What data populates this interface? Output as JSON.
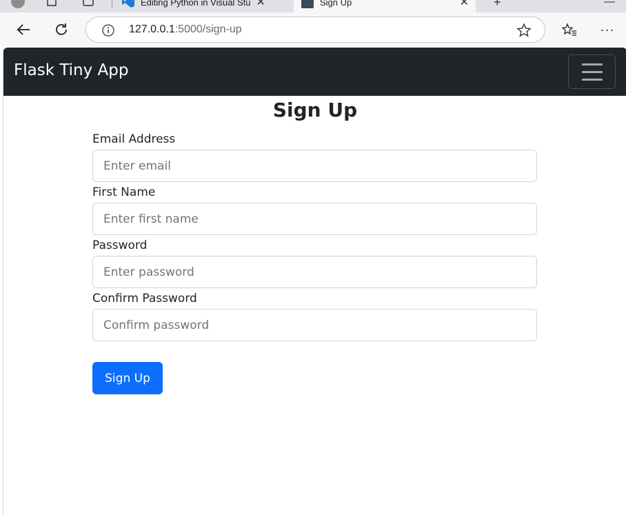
{
  "browser": {
    "tabs": [
      {
        "label": "Editing Python in Visual Stu"
      },
      {
        "label": "Sign Up"
      }
    ],
    "address": {
      "host": "127.0.0.1",
      "path": ":5000/sign-up"
    }
  },
  "navbar": {
    "brand": "Flask Tiny App"
  },
  "form": {
    "title": "Sign Up",
    "fields": [
      {
        "label": "Email Address",
        "placeholder": "Enter email"
      },
      {
        "label": "First Name",
        "placeholder": "Enter first name"
      },
      {
        "label": "Password",
        "placeholder": "Enter password"
      },
      {
        "label": "Confirm Password",
        "placeholder": "Confirm password"
      }
    ],
    "submit_label": "Sign Up"
  },
  "colors": {
    "navbar_bg": "#212529",
    "primary": "#0d6efd"
  },
  "icons": [
    "profile-icon",
    "workspaces-icon",
    "tab-actions-icon",
    "vscode-icon",
    "page-icon",
    "back-icon",
    "reload-icon",
    "info-icon",
    "favorite-star-icon",
    "favorites-icon",
    "more-icon",
    "hamburger-icon"
  ]
}
